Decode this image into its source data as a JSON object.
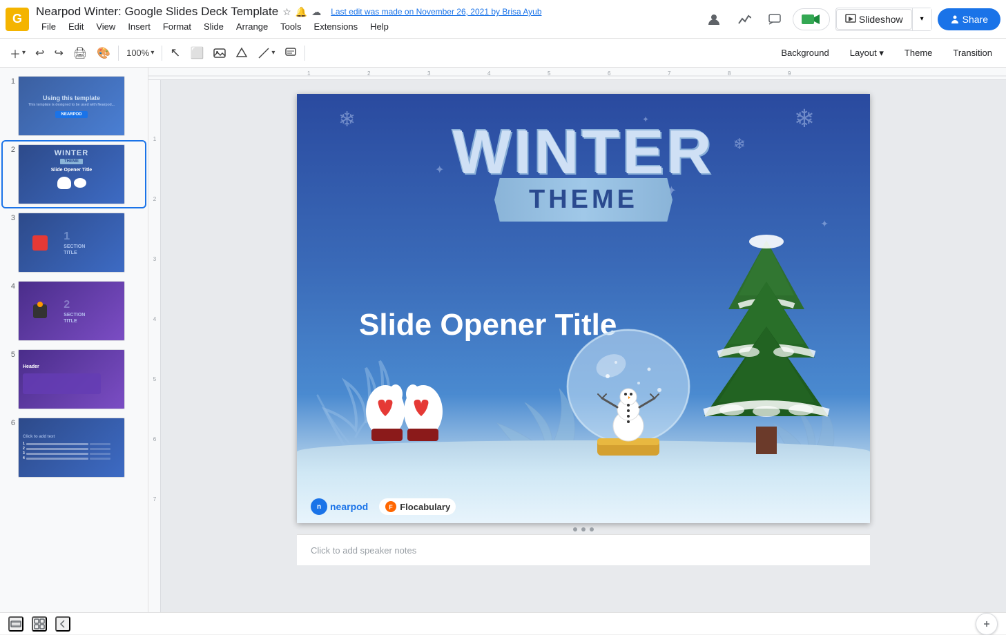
{
  "app": {
    "logo_letter": "G",
    "title": "Nearpod Winter: Google Slides Deck Template",
    "star_icon": "★",
    "bell_icon": "🔔",
    "cloud_icon": "☁",
    "last_edit": "Last edit was made on November 26, 2021 by Brisa Ayub"
  },
  "menu": {
    "items": [
      "File",
      "Edit",
      "View",
      "Insert",
      "Format",
      "Slide",
      "Arrange",
      "Tools",
      "Extensions",
      "Help"
    ]
  },
  "toolbar": {
    "add_btn": "+",
    "undo": "↩",
    "redo": "↪",
    "print": "🖨",
    "paint": "🎨",
    "zoom": "100%",
    "cursor": "↖",
    "frame": "⬜",
    "image": "🖼",
    "shape": "⬡",
    "line": "╱",
    "comment": "💬"
  },
  "slide_toolbar": {
    "background_label": "Background",
    "layout_label": "Layout",
    "layout_arrow": "▾",
    "theme_label": "Theme",
    "transition_label": "Transition"
  },
  "top_right": {
    "presenter_icon": "👤",
    "analytics_icon": "↗",
    "chat_icon": "💬",
    "meet_label": "",
    "slideshow_label": "Slideshow",
    "dropdown_arrow": "▾",
    "share_icon": "👤",
    "share_label": "Share"
  },
  "slides": [
    {
      "num": "1",
      "type": "intro"
    },
    {
      "num": "2",
      "type": "winter-main"
    },
    {
      "num": "3",
      "type": "section-1"
    },
    {
      "num": "4",
      "type": "section-2"
    },
    {
      "num": "5",
      "type": "header"
    },
    {
      "num": "6",
      "type": "list"
    }
  ],
  "current_slide": {
    "winter_big": "WINTER",
    "theme_big": "THEME",
    "opener_title": "Slide Opener Title",
    "nearpod": "nearpod",
    "flocabulary": "Flocabulary"
  },
  "notes": {
    "placeholder": "Click to add speaker notes"
  },
  "bottom": {
    "view1_icon": "☰",
    "view2_icon": "⊞",
    "collapse_icon": "◀"
  }
}
